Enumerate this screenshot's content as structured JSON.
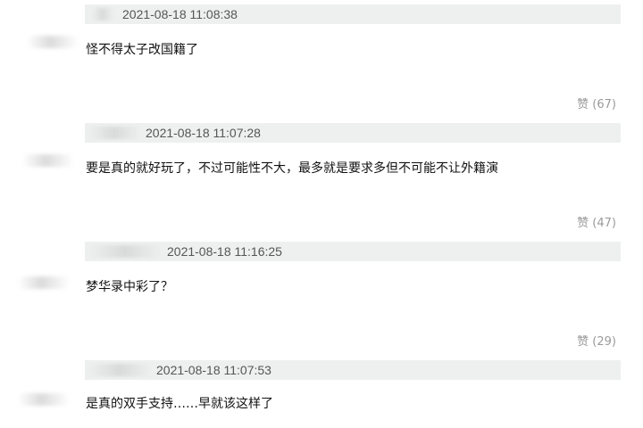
{
  "comments": [
    {
      "timestamp": "2021-08-18 11:08:38",
      "content": "怪不得太子改国籍了",
      "like_label": "赞 (67)"
    },
    {
      "timestamp": "2021-08-18 11:07:28",
      "content": "要是真的就好玩了，不过可能性不大，最多就是要求多但不可能不让外籍演",
      "like_label": "赞 (47)"
    },
    {
      "timestamp": "2021-08-18 11:16:25",
      "content": "梦华录中彩了？",
      "like_label": "赞 (29)"
    },
    {
      "timestamp": "2021-08-18 11:07:53",
      "content": "是真的双手支持……早就该这样了",
      "like_label": ""
    }
  ]
}
